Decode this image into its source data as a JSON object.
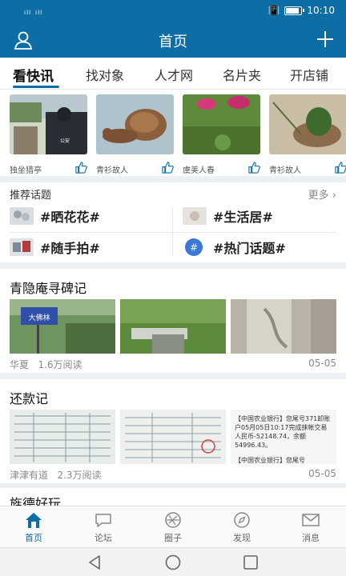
{
  "status_bar": {
    "signal": "ᵢₗₗ ᵢₗₗ",
    "time": "10:10"
  },
  "header": {
    "title": "首页",
    "user_icon": "user-icon",
    "add_icon": "plus-icon"
  },
  "tabs": [
    "看快讯",
    "找对象",
    "人才网",
    "名片夹",
    "开店铺"
  ],
  "quick_news": [
    {
      "author": "独坐猎亭"
    },
    {
      "author": "青衫故人"
    },
    {
      "author": "虞美人春"
    },
    {
      "author": "青衫故人"
    }
  ],
  "topics": {
    "title": "推荐话题",
    "more": "更多",
    "items": [
      "#晒花花#",
      "#生活居#",
      "#随手拍#",
      "#热门话题#"
    ]
  },
  "posts": [
    {
      "title": "青隐庵寻碑记",
      "author": "华夏",
      "reads": "1.6万阅读",
      "date": "05-05",
      "sign_text": "大佛林"
    },
    {
      "title": "还款记",
      "author": "津津有道",
      "reads": "2.3万阅读",
      "date": "05-05",
      "sms_text": "【中国农业银行】您尾号371卸账户05月05日10:17完成抹帐交易人民币-52148.74，余额54996.43。",
      "sms_text_2": "【中国农业银行】您尾号"
    },
    {
      "title": "旌德好玩"
    }
  ],
  "bottom_nav": [
    {
      "label": "首页",
      "icon": "home-icon"
    },
    {
      "label": "论坛",
      "icon": "chat-bubble-icon"
    },
    {
      "label": "圈子",
      "icon": "aperture-icon"
    },
    {
      "label": "发现",
      "icon": "compass-icon"
    },
    {
      "label": "消息",
      "icon": "mail-icon"
    }
  ],
  "colors": {
    "brand": "#0d6ea6",
    "background": "#eef1f3"
  }
}
